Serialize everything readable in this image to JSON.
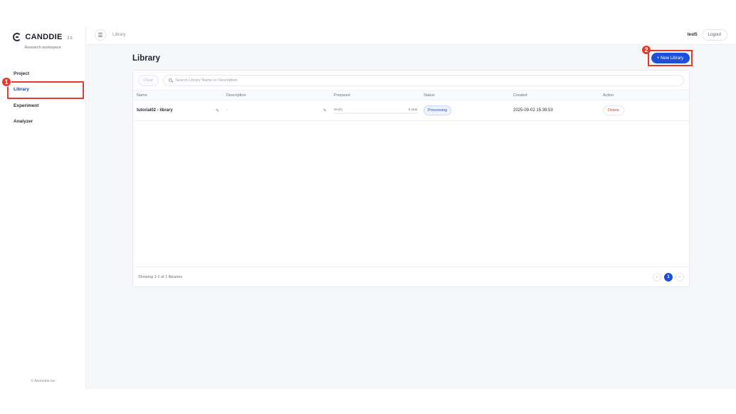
{
  "sidebar": {
    "brand": "CANDDIE",
    "version": "2.0",
    "workspace": "Research workspace",
    "items": [
      {
        "label": "Project",
        "active": false
      },
      {
        "label": "Library",
        "active": true
      },
      {
        "label": "Experiment",
        "active": false
      },
      {
        "label": "Analyzer",
        "active": false
      }
    ],
    "copyright": "© Atomotrie Inc"
  },
  "annotations": {
    "badge1": "1",
    "badge2": "2"
  },
  "topbar": {
    "breadcrumb": "Library",
    "username": "test5",
    "logout_label": "Logout"
  },
  "page": {
    "title": "Library",
    "new_button_label": "+ New Library"
  },
  "table": {
    "clear_label": "Clear",
    "search_placeholder": "Search Library Name or Description",
    "columns": [
      "Name",
      "Description",
      "Prepared",
      "Status",
      "Created",
      "Action"
    ],
    "rows": [
      {
        "name": "tutorial02 - library",
        "description": "-",
        "prepared_left": "0%(0)",
        "prepared_right": "0 total",
        "prepared_fraction": 0.0,
        "status": "Processing",
        "created": "2025-09-02 15:39:53",
        "action": "Delete"
      }
    ],
    "footer_text": "Showing 1-1 of 1 libraries",
    "pagination": {
      "prev": "‹",
      "current": "1",
      "next": "›"
    }
  },
  "colors": {
    "accent": "#1d4fd8",
    "highlight": "#e23a2f"
  }
}
